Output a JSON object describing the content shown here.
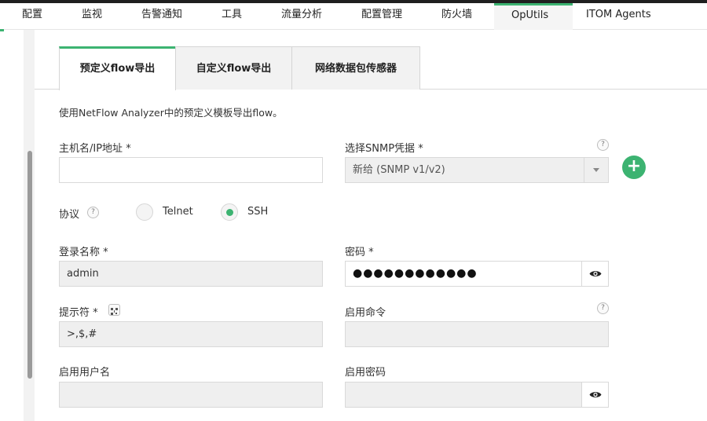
{
  "nav": {
    "items": [
      "配置",
      "监视",
      "告警通知",
      "工具",
      "流量分析",
      "配置管理",
      "防火墙",
      "OpUtils",
      "ITOM Agents"
    ],
    "selected": "OpUtils"
  },
  "tabs": [
    "预定义flow导出",
    "自定义flow导出",
    "网络数据包传感器"
  ],
  "active_tab": "预定义flow导出",
  "description": "使用NetFlow Analyzer中的预定义模板导出flow。",
  "form": {
    "host_label": "主机名/IP地址",
    "host_value": "",
    "snmp_label": "选择SNMP凭据",
    "snmp_value": "新给 (SNMP v1/v2)",
    "protocol_label": "协议",
    "protocol_options": [
      "Telnet",
      "SSH"
    ],
    "protocol_selected": "SSH",
    "login_label": "登录名称",
    "login_value": "admin",
    "password_label": "密码",
    "password_value": "●●●●●●●●●●●●",
    "prompt_label": "提示符",
    "prompt_value": ">,$,#",
    "enable_cmd_label": "启用命令",
    "enable_cmd_value": "",
    "enable_user_label": "启用用户名",
    "enable_user_value": "",
    "enable_pwd_label": "启用密码",
    "enable_pwd_value": "",
    "required_mark": "*",
    "help_glyph": "?",
    "add_glyph": "+"
  },
  "colors": {
    "accent": "#3cb371",
    "topbar": "#1f1f1f"
  }
}
